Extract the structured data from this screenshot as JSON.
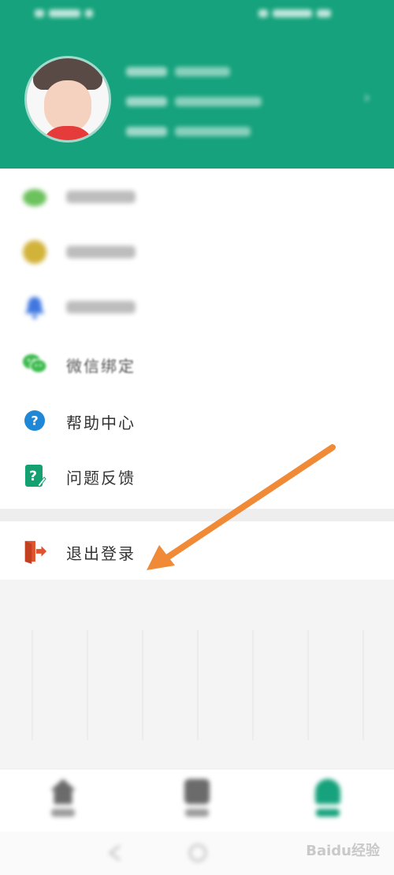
{
  "menu": {
    "items": [
      {
        "label": "微信绑定"
      },
      {
        "label": "帮助中心"
      },
      {
        "label": "问题反馈"
      }
    ],
    "logout_label": "退出登录"
  },
  "watermark": "Baidu经验",
  "colors": {
    "header_green": "#15a27c",
    "arrow": "#f08a36",
    "wechat_green": "#3dbb4e",
    "help_blue": "#1e88d6",
    "feedback_green": "#14a070",
    "logout_red": "#e0532c"
  },
  "icons": {
    "wechat": "wechat-icon",
    "help": "question-circle-icon",
    "feedback": "feedback-edit-icon",
    "logout": "logout-door-icon"
  }
}
